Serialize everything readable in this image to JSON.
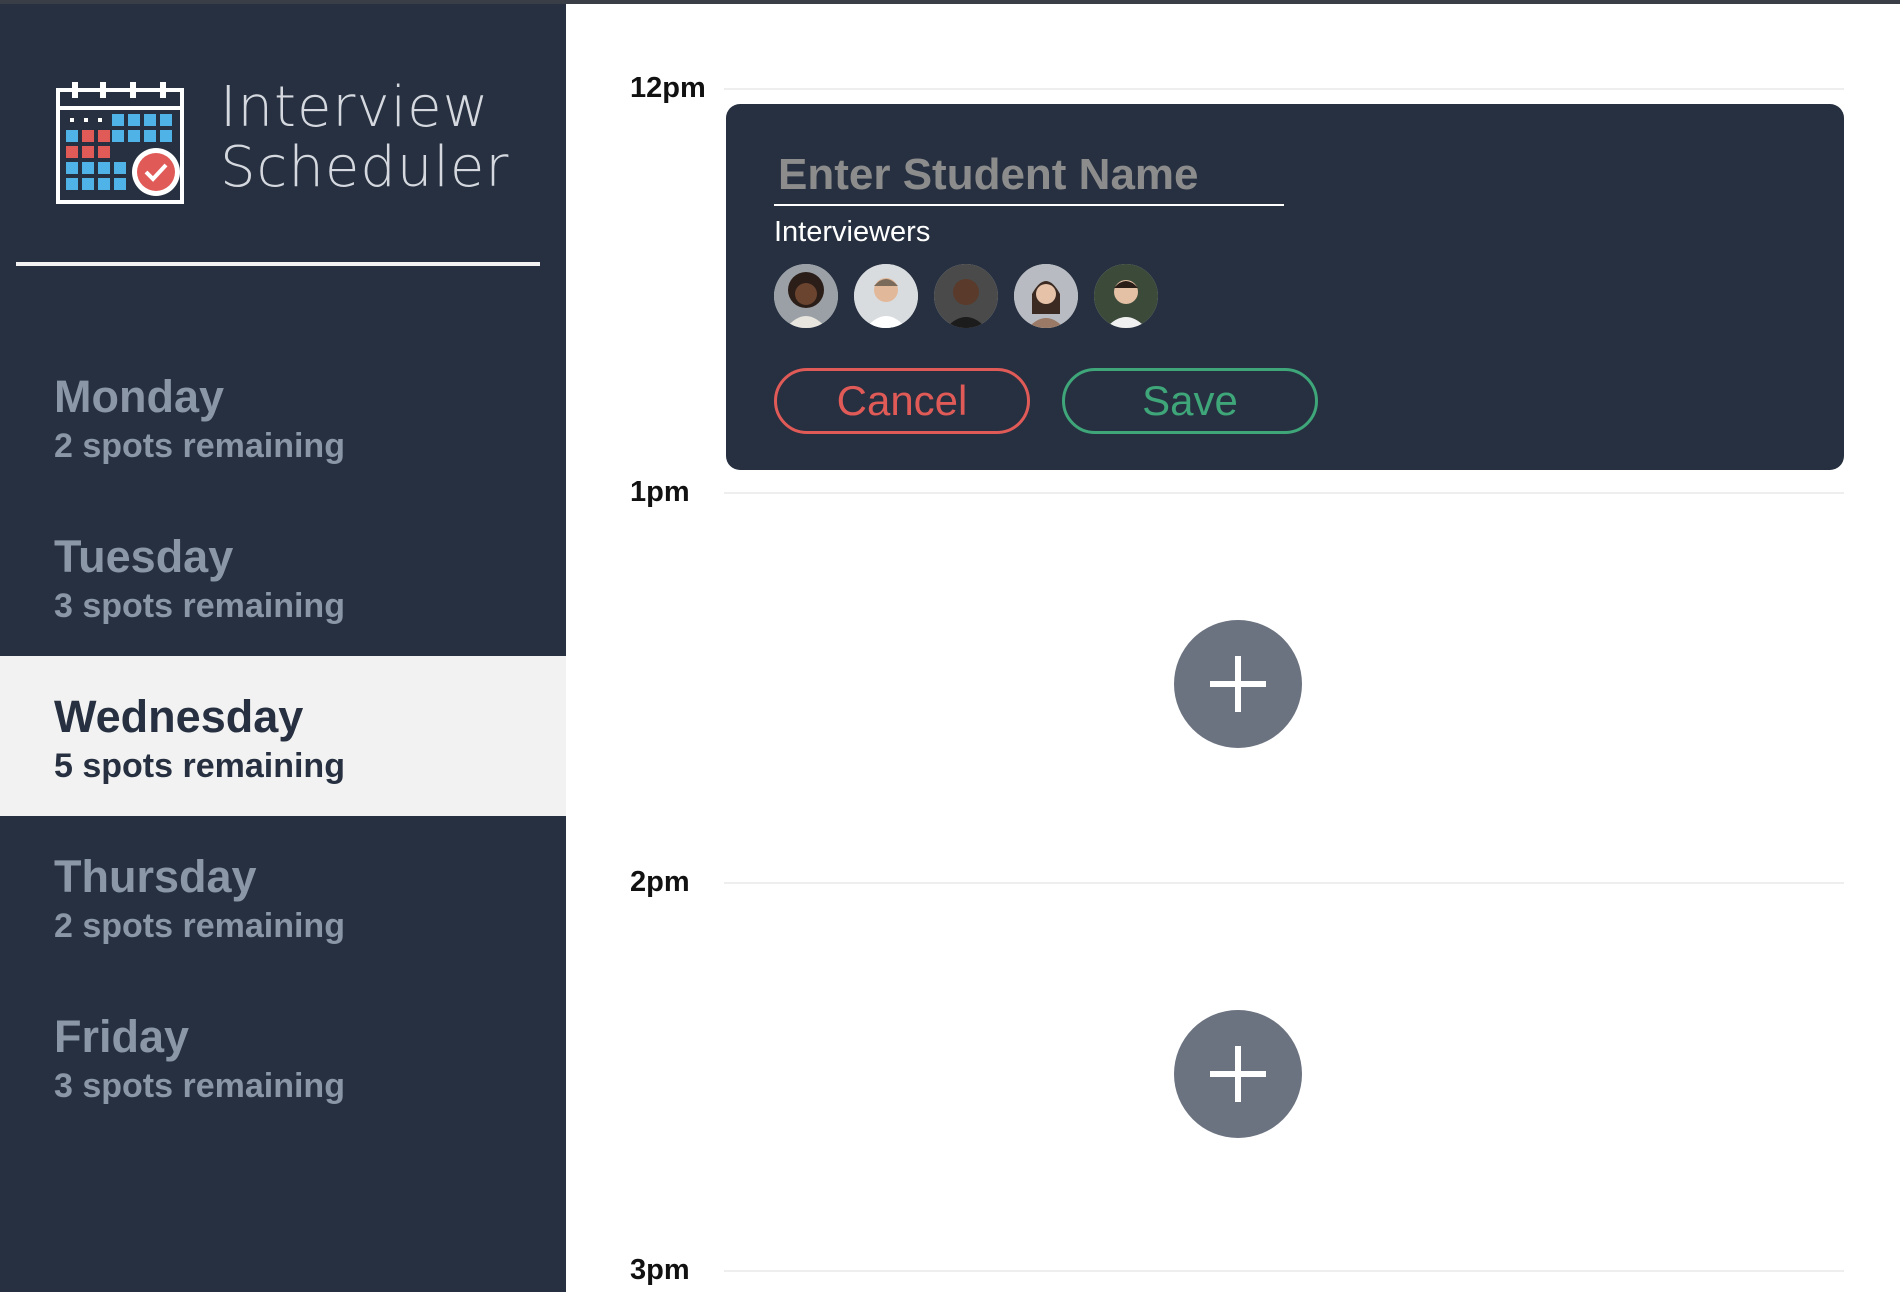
{
  "app": {
    "title_line1": "Interview",
    "title_line2": "Scheduler",
    "logo_icon": "calendar-check-icon"
  },
  "days": [
    {
      "name": "Monday",
      "spots": "2 spots remaining",
      "selected": false
    },
    {
      "name": "Tuesday",
      "spots": "3 spots remaining",
      "selected": false
    },
    {
      "name": "Wednesday",
      "spots": "5 spots remaining",
      "selected": true
    },
    {
      "name": "Thursday",
      "spots": "2 spots remaining",
      "selected": false
    },
    {
      "name": "Friday",
      "spots": "3 spots remaining",
      "selected": false
    }
  ],
  "schedule": {
    "times": [
      "12pm",
      "1pm",
      "2pm",
      "3pm"
    ],
    "form": {
      "student_placeholder": "Enter Student Name",
      "student_value": "",
      "interviewers_label": "Interviewers",
      "interviewers": [
        "avatar-1",
        "avatar-2",
        "avatar-3",
        "avatar-4",
        "avatar-5"
      ],
      "cancel_label": "Cancel",
      "save_label": "Save"
    },
    "add_icon": "plus-icon"
  },
  "colors": {
    "sidebar_bg": "#263040",
    "selected_bg": "#f2f2f2",
    "muted_text": "#8b96a6",
    "danger": "#e05a57",
    "success": "#3fa67a",
    "add_button": "#6b7280"
  }
}
